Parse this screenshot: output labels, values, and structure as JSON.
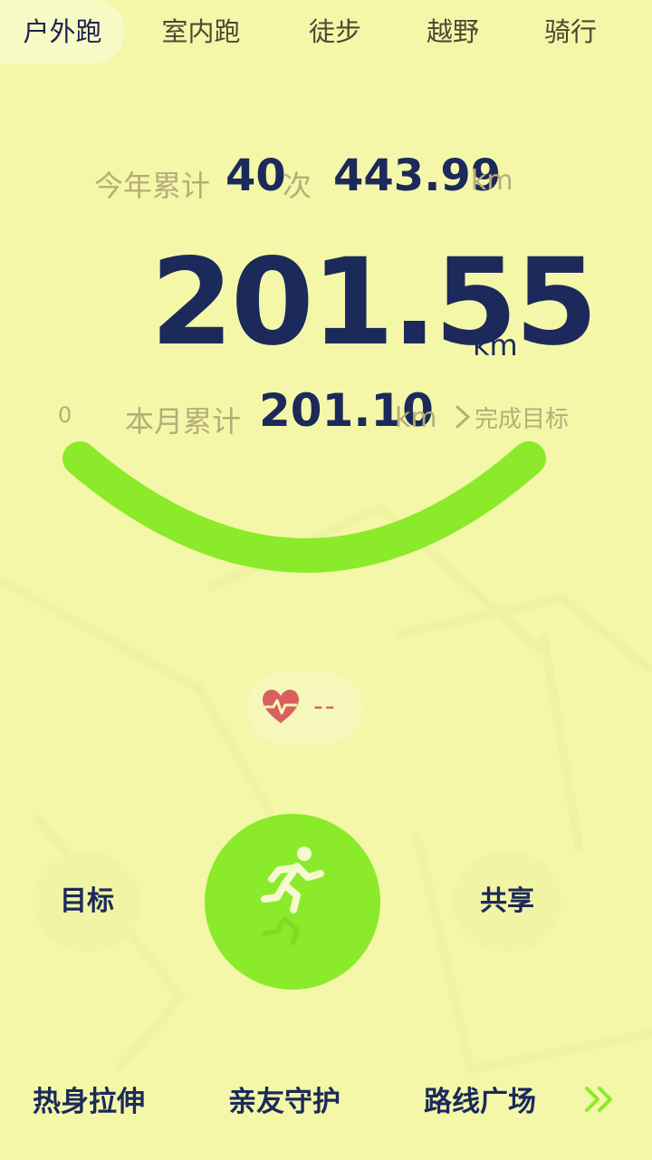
{
  "tabs": [
    {
      "label": "户外跑",
      "active": true
    },
    {
      "label": "室内跑",
      "active": false
    },
    {
      "label": "徒步",
      "active": false
    },
    {
      "label": "越野",
      "active": false
    },
    {
      "label": "骑行",
      "active": false
    }
  ],
  "year_stats": {
    "label": "今年累计",
    "count": "40",
    "count_unit": "次",
    "distance": "443.99",
    "distance_unit": "km"
  },
  "main_value": {
    "value": "201.55",
    "unit": "km"
  },
  "month_stats": {
    "start_label": "0",
    "label": "本月累计",
    "value": "201.10",
    "unit": "km",
    "goal_link": "完成目标"
  },
  "progress": {
    "fraction": 1.0,
    "color": "#8BEA2A"
  },
  "heart_rate": {
    "value": "--",
    "icon": "heart-rate-icon",
    "color": "#d8615f"
  },
  "actions": {
    "goal_label": "目标",
    "share_label": "共享",
    "start_icon": "running-person-icon"
  },
  "bottom_bar": {
    "items": [
      "热身拉伸",
      "亲友守护",
      "路线广场"
    ],
    "more_icon": "double-chevron-right-icon"
  },
  "colors": {
    "background": "#F4F7A8",
    "accent": "#8BEA2A",
    "text": "#1b2a5a",
    "muted": "#b6ad79"
  }
}
